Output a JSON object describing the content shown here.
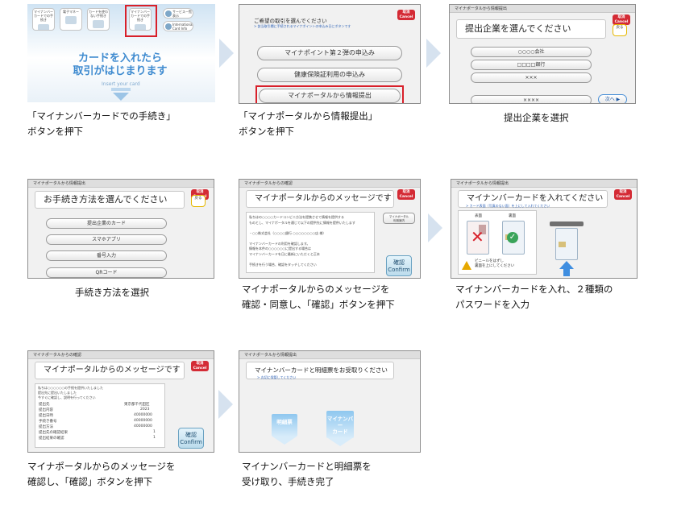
{
  "colors": {
    "highlight": "#d8202a",
    "cancel": "#d42b35",
    "arrow": "#d6e2ef",
    "link_blue": "#2a5fb5"
  },
  "screen1": {
    "buttons": [
      "マイナンバーカードでの手続き",
      "電子マネー",
      "カードを使わない手続き",
      "マイナンバーカードでの手続き"
    ],
    "round_buttons": [
      "サービス一覧表示",
      "International Card Info"
    ],
    "insert_text": "カードを入れたら\n取引がはじまります",
    "insert_en": "Insert your card",
    "caption": "「マイナンバーカードでの手続き」\nボタンを押下"
  },
  "screen2": {
    "title": "ご希望の取引を選んでください",
    "sub": "> 該当取引欄に手続されるマイナポイントの申込み日にボタンです",
    "options": [
      "マイナポイント第２弾の申込み",
      "健康保険証利用の申込み",
      "マイナポータルから情報提出"
    ],
    "caption": "「マイナポータルから情報提出」\nボタンを押下"
  },
  "screen3": {
    "header": "マイナポータルから情報提出",
    "title": "提出企業を選んでください",
    "back": "戻る",
    "options": [
      "○○○○会社",
      "□□□□銀行",
      "×××",
      "××××"
    ],
    "next": "次へ ▶",
    "caption": "提出企業を選択"
  },
  "screen4": {
    "header": "マイナポータルから情報提出",
    "title": "お手続き方法を選んでください",
    "back": "戻る",
    "options": [
      "提出企業のカード",
      "スマホアプリ",
      "番号入力",
      "QRコード"
    ],
    "caption": "手続き方法を選択"
  },
  "screen5": {
    "header": "マイナポータルからの確認",
    "title": "マイナポータルからのメッセージです",
    "side_btn": "マイナポータル\n利用案内",
    "message": "私ちはの○○○○カードコンビニ方法を提携させて情報を提供する\nものとし、マイナポータルを通じて以下の提供先に情報を提供いたします\n\n  ・○○株式会社（○○○○銀行 ○○○○○○○○店 様）\n\nマイナンバーカードの利用を確認します。\n情報を本件の○○○○○○に提出する場合は\nマイナンバーカードを日に最新にいただくと正本\n\n手続きを行う場合、確認をタッチしてください",
    "confirm": "確認\nConfirm",
    "caption": "マイナポータルからのメッセージを\n確認・同意し、「確認」ボタンを押下"
  },
  "screen6": {
    "header": "マイナポータルから情報提出",
    "title": "マイナンバーカードを入れてください",
    "sub": "> カード表面（写真のない面）を上にして入れてください",
    "label_back": "表面",
    "label_front": "裏面",
    "warning": "ビニールをはずし\n裏面を上にしてください",
    "caption": "マイナンバーカードを入れ、２種類の\nパスワードを入力"
  },
  "screen7": {
    "header": "マイナポータルからの確認",
    "title": "マイナポータルからのメッセージです",
    "message": "私ちは○○○○○○の手続を提供いたしました\n提出先に提出いたしました\n今すぐに確認し、説明を行ってください",
    "rows": [
      [
        "提出先",
        "東京都千代田区"
      ],
      [
        "提出内容",
        "2023"
      ],
      [
        "提出日時",
        "40000000"
      ],
      [
        "手続き番号",
        "40000000"
      ],
      [
        "提出方法",
        "40000000"
      ],
      [
        "提出先の確認結果",
        "1"
      ],
      [
        "提出結果の確認",
        "1"
      ]
    ],
    "confirm": "確認\nConfirm",
    "caption": "マイナポータルからのメッセージを\n確認し、「確認」ボタンを押下"
  },
  "screen8": {
    "header": "マイナポータルから情報提出",
    "title": "マイナンバーカードと明細票をお受取りください",
    "sub": "> 丸切に保管してください",
    "eject_receipt": "明細票",
    "eject_card": "マイナンバー\nカード",
    "caption": "マイナンバーカードと明細票を\n受け取り、手続き完了"
  },
  "common": {
    "cancel": "取消\nCancel"
  }
}
